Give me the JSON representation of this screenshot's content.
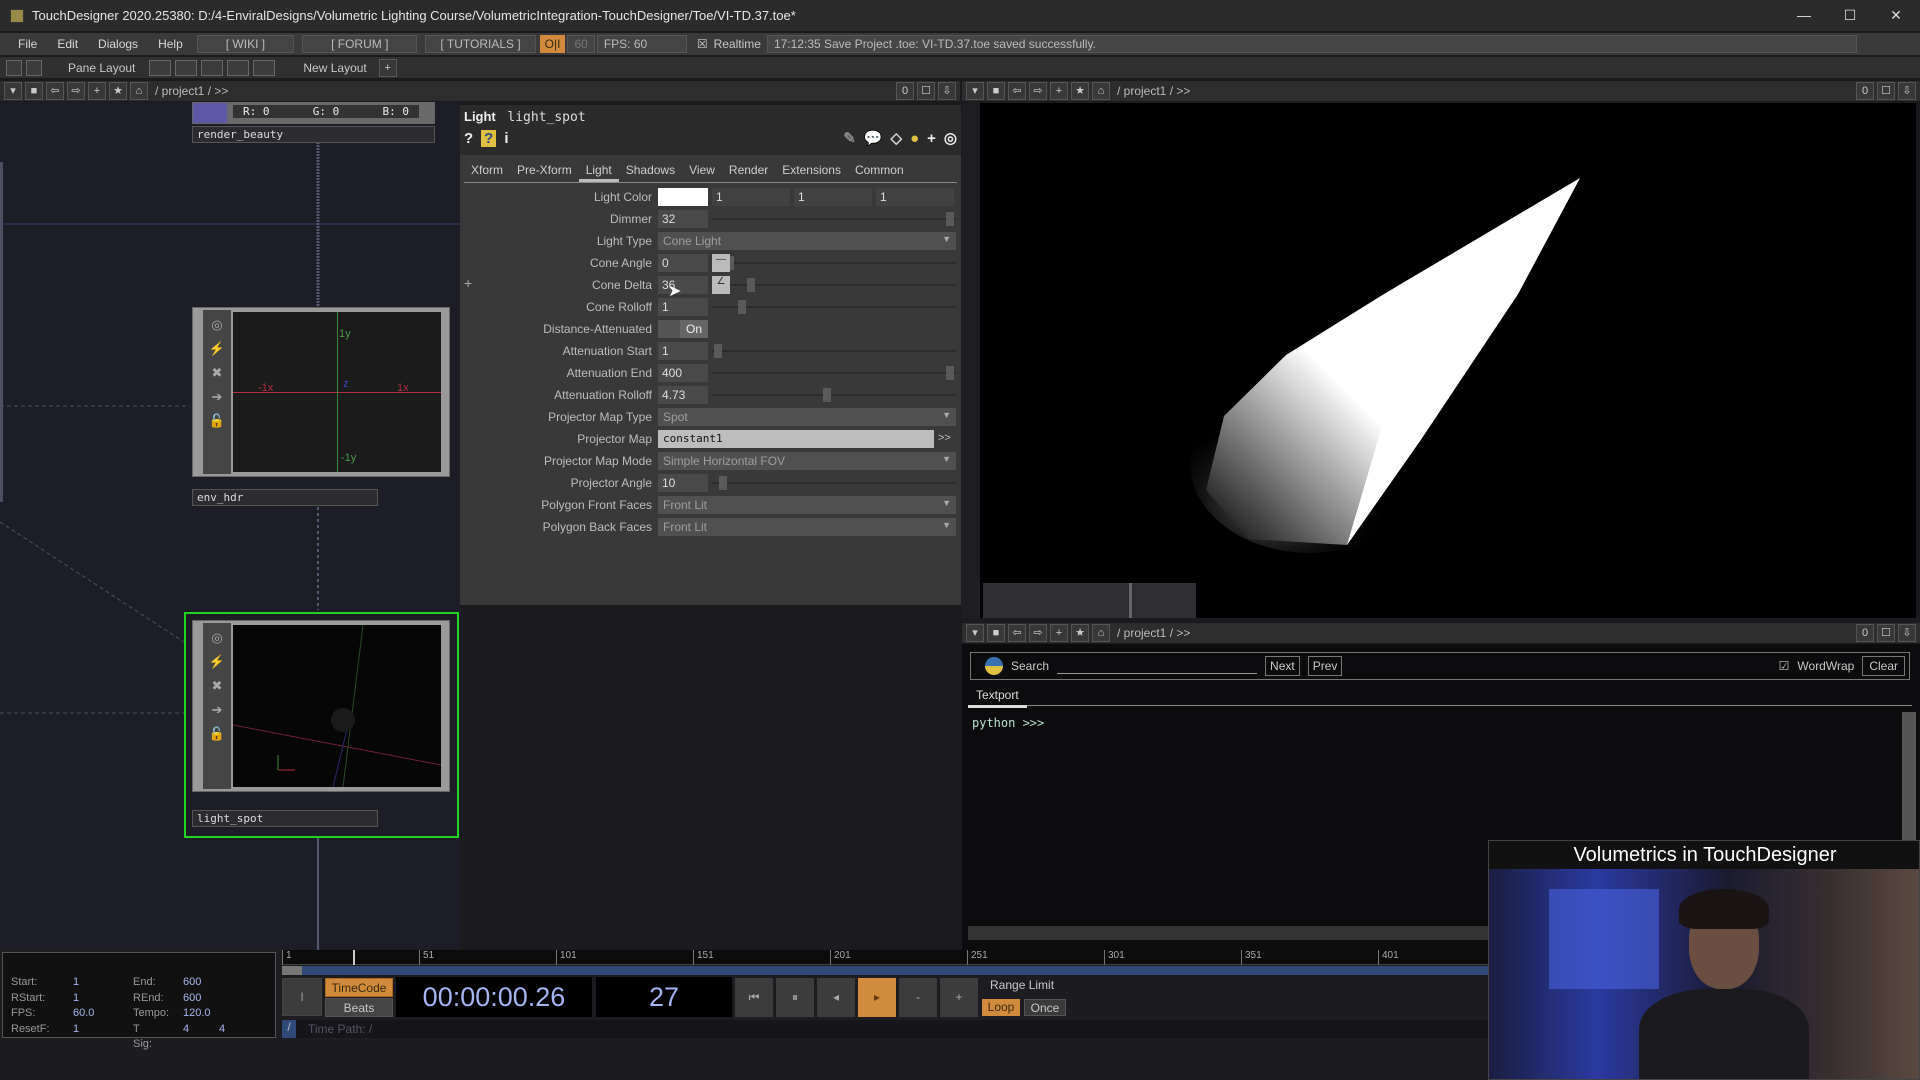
{
  "window": {
    "title": "TouchDesigner 2020.25380: D:/4-EnviralDesigns/Volumetric Lighting Course/VolumetricIntegration-TouchDesigner/Toe/VI-TD.37.toe*",
    "minimize": "—",
    "maximize": "☐",
    "close": "✕"
  },
  "menubar": {
    "items": [
      "File",
      "Edit",
      "Dialogs",
      "Help"
    ],
    "wiki": "[ WIKI ]",
    "forum": "[ FORUM ]",
    "tutorials": "[ TUTORIALS ]",
    "perform": "O|I",
    "fps_cap": "60",
    "fps": "FPS:  60",
    "realtime_check": "☒",
    "realtime": "Realtime",
    "status": "17:12:35 Save Project .toe: VI-TD.37.toe saved successfully."
  },
  "panebar": {
    "pane_layout": "Pane Layout",
    "new_layout": "New Layout",
    "add": "+"
  },
  "pathbar": {
    "path": "/ project1 / >>",
    "zero": "0"
  },
  "network": {
    "rgb": {
      "r": "R: 0",
      "g": "G: 0",
      "b": "B: 0"
    },
    "nodes": [
      {
        "name": "render_beauty"
      },
      {
        "name": "env_hdr",
        "axes": {
          "py": "1y",
          "ny": "-1y",
          "px": "1x",
          "nx": "-1x",
          "z": "z"
        }
      },
      {
        "name": "light_spot",
        "selected": true
      }
    ]
  },
  "params": {
    "op_type": "Light",
    "op_name": "light_spot",
    "tabs": [
      "Xform",
      "Pre-Xform",
      "Light",
      "Shadows",
      "View",
      "Render",
      "Extensions",
      "Common"
    ],
    "active_tab": "Light",
    "rows": [
      {
        "label": "Light Color",
        "type": "color",
        "values": [
          "1",
          "1",
          "1"
        ],
        "color": "#ffffff"
      },
      {
        "label": "Dimmer",
        "value": "32",
        "slider": 0.99
      },
      {
        "label": "Light Type",
        "type": "menu",
        "value": "Cone Light"
      },
      {
        "label": "Cone Angle",
        "value": "0",
        "slider": 0.06
      },
      {
        "label": "Cone Delta",
        "value": "36",
        "slider": 0.15
      },
      {
        "label": "Cone Rolloff",
        "value": "1",
        "slider": 0.11
      },
      {
        "label": "Distance-Attenuated",
        "type": "toggle",
        "value": "On"
      },
      {
        "label": "Attenuation Start",
        "value": "1",
        "slider": 0.01
      },
      {
        "label": "Attenuation End",
        "value": "400",
        "slider": 0.99
      },
      {
        "label": "Attenuation Rolloff",
        "value": "4.73",
        "slider": 0.47
      },
      {
        "label": "Projector Map Type",
        "type": "menu",
        "value": "Spot"
      },
      {
        "label": "Projector Map",
        "type": "op",
        "value": "constant1",
        "arrow": ">>"
      },
      {
        "label": "Projector Map Mode",
        "type": "menu",
        "value": "Simple Horizontal FOV"
      },
      {
        "label": "Projector Angle",
        "value": "10",
        "slider": 0.03
      },
      {
        "label": "Polygon Front Faces",
        "type": "menu",
        "value": "Front Lit"
      },
      {
        "label": "Polygon Back Faces",
        "type": "menu",
        "value": "Front Lit"
      }
    ]
  },
  "textport": {
    "search": "Search",
    "next": "Next",
    "prev": "Prev",
    "wordwrap": "WordWrap",
    "wordwrap_checked": true,
    "clear": "Clear",
    "tab": "Textport",
    "prompt": "python >>>"
  },
  "timeline": {
    "ticks": [
      "1",
      "51",
      "101",
      "151",
      "201",
      "251",
      "301",
      "351",
      "401"
    ],
    "current_frame": 27,
    "info": [
      [
        "Start:",
        "1",
        "End:",
        "600"
      ],
      [
        "RStart:",
        "1",
        "REnd:",
        "600"
      ],
      [
        "FPS:",
        "60.0",
        "Tempo:",
        "120.0"
      ],
      [
        "ResetF:",
        "1",
        "T Sig:",
        "4",
        "4"
      ]
    ],
    "timecode": "TimeCode",
    "beats": "Beats",
    "time": "00:00:00.26",
    "frame": "27",
    "range_limit": "Range Limit",
    "loop": "Loop",
    "once": "Once",
    "time_path": "Time Path: /",
    "slash": "/",
    "buttons": [
      "⏮",
      "⏸",
      "◂",
      "▸",
      "-",
      "+"
    ]
  },
  "webcam": {
    "title": "Volumetrics in TouchDesigner"
  },
  "colors": {
    "accent": "#d28a3c",
    "selected_node": "#22d422",
    "timecode_text": "#a6b4f0"
  }
}
